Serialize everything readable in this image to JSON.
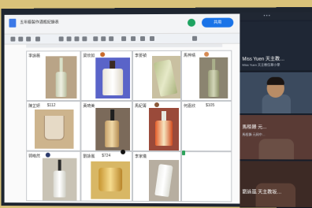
{
  "doc": {
    "title": "五年級製作酒瓶紀錄表",
    "share_label": "共用"
  },
  "table": {
    "rows": [
      [
        {
          "name": "李詠薇",
          "amount": ""
        },
        {
          "name": "梁欣如",
          "amount": ""
        },
        {
          "name": "李晏禎",
          "amount": ""
        },
        {
          "name": "馬梓晴",
          "amount": ""
        }
      ],
      [
        {
          "name": "陳芷妍",
          "amount": "$112"
        },
        {
          "name": "黃琦美",
          "amount": ""
        },
        {
          "name": "馬紀菁",
          "amount": ""
        },
        {
          "name": "何嘉欣",
          "amount": "$105"
        }
      ],
      [
        {
          "name": "郭皓然",
          "amount": ""
        },
        {
          "name": "劉詠嵐",
          "amount": "$724"
        },
        {
          "name": "李家儀",
          "amount": ""
        },
        {
          "name": "",
          "amount": ""
        }
      ]
    ]
  },
  "zoom": {
    "participants": [
      {
        "name": "Miss Yuen  天主教…",
        "sub": "Miss Yuen 天主教伍華小學"
      },
      {
        "name": "",
        "sub": ""
      },
      {
        "name": "馬栢鋒  元...",
        "sub": "馬栢鋒 元岡中…"
      },
      {
        "name": "劉詠嵐  天主教坂…",
        "sub": ""
      }
    ]
  }
}
